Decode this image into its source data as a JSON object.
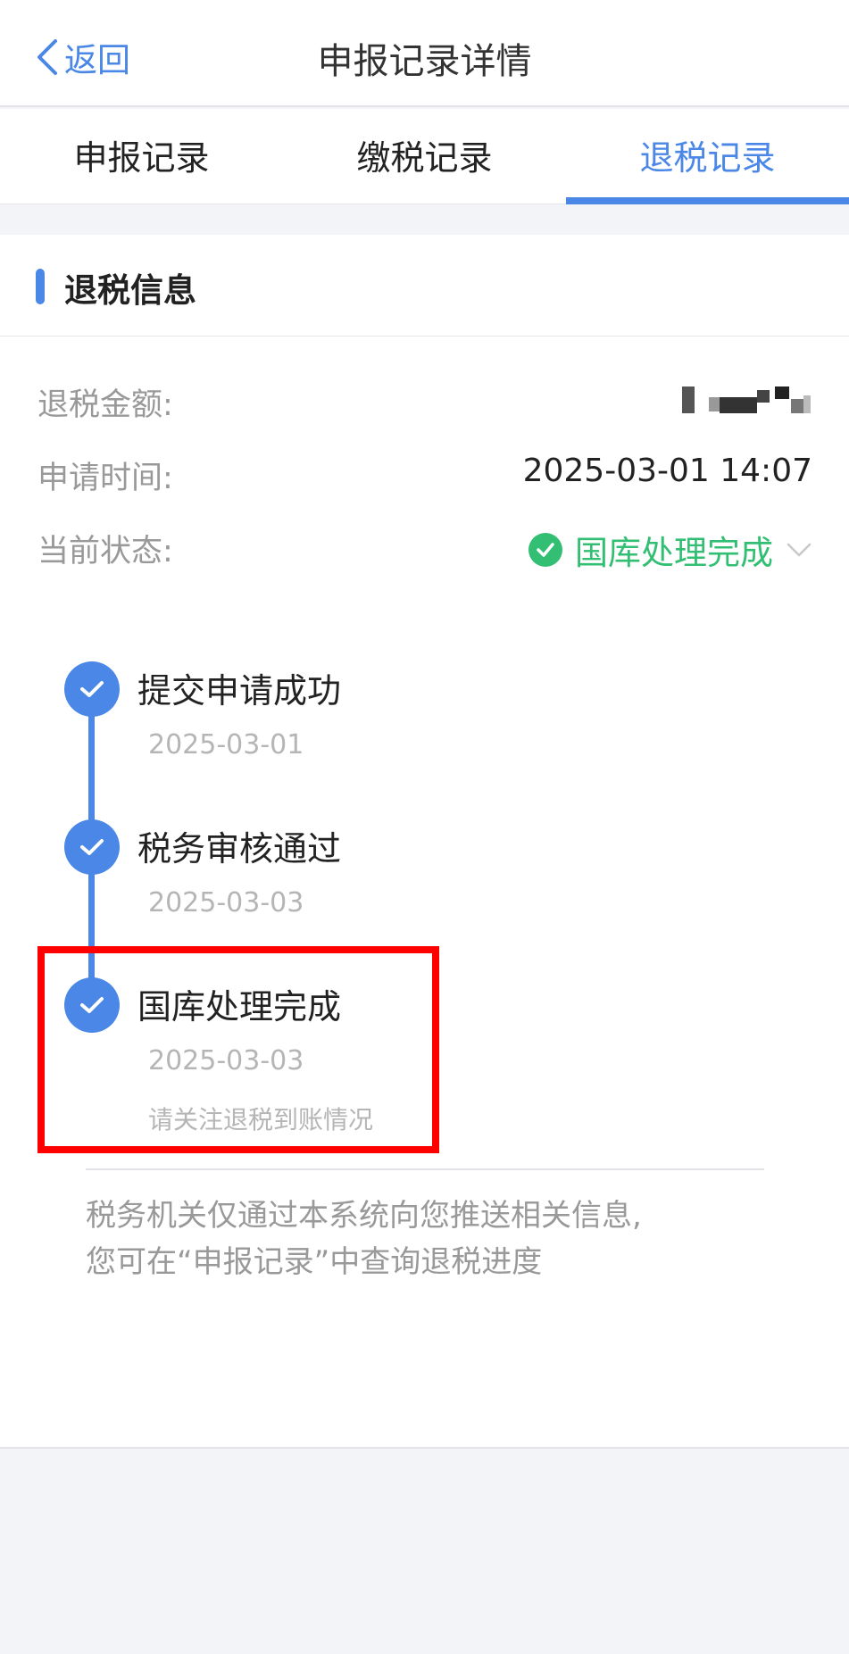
{
  "navbar": {
    "back_label": "返回",
    "title": "申报记录详情"
  },
  "tabs": [
    {
      "label": "申报记录",
      "active": false
    },
    {
      "label": "缴税记录",
      "active": false
    },
    {
      "label": "退税记录",
      "active": true
    }
  ],
  "section": {
    "title": "退税信息"
  },
  "info": {
    "amount_label": "退税金额:",
    "time_label": "申请时间:",
    "time_value": "2025-03-01 14:07",
    "status_label": "当前状态:",
    "status_value": "国库处理完成"
  },
  "timeline": [
    {
      "title": "提交申请成功",
      "date": "2025-03-01"
    },
    {
      "title": "税务审核通过",
      "date": "2025-03-03"
    },
    {
      "title": "国库处理完成",
      "date": "2025-03-03",
      "note": "请关注退税到账情况"
    }
  ],
  "footnote": {
    "line1": "税务机关仅通过本系统向您推送相关信息,",
    "line2": "您可在“申报记录”中查询退税进度"
  },
  "colors": {
    "accent": "#4a87e6",
    "success": "#33bf73",
    "highlight": "#ff0000"
  },
  "icons": {
    "back": "chevron-left-icon",
    "status": "check-circle-icon",
    "expand": "chevron-down-icon",
    "step": "check-icon"
  }
}
